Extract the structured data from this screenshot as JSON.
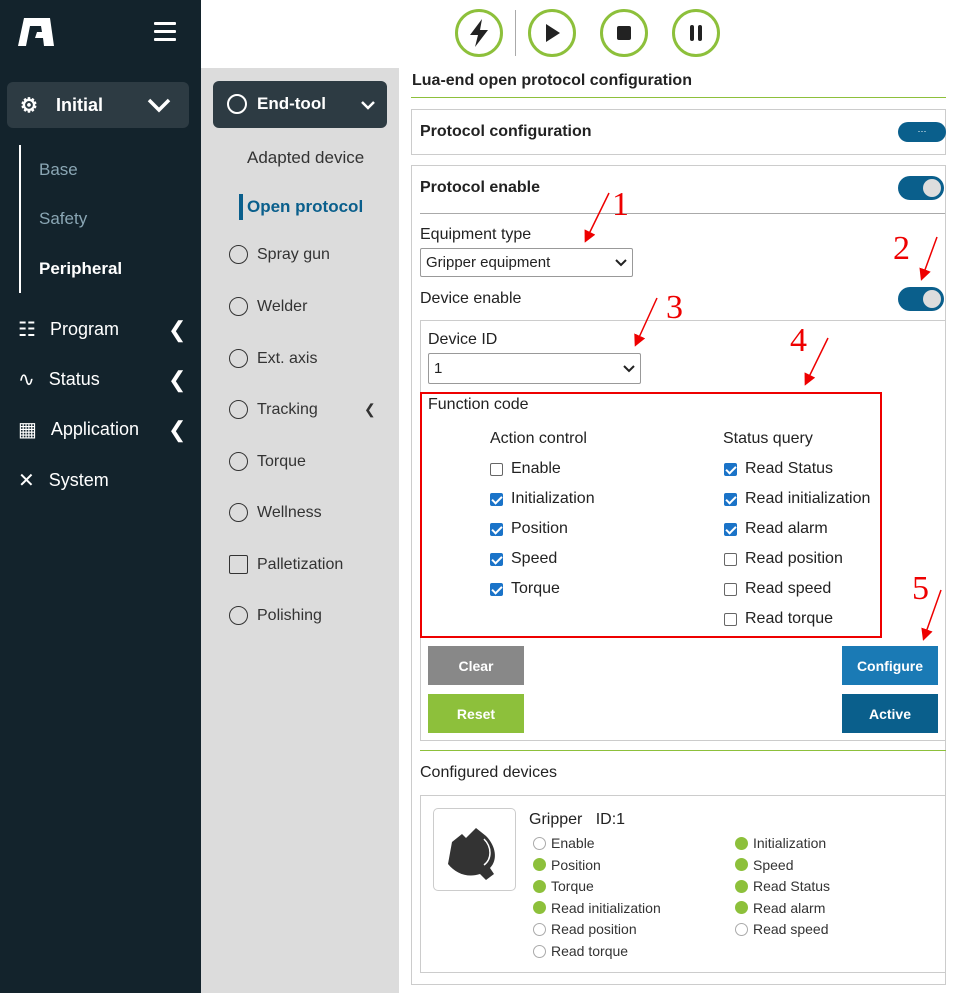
{
  "sidebar": {
    "initial": "Initial",
    "subitems": [
      "Base",
      "Safety",
      "Peripheral"
    ],
    "nav": [
      "Program",
      "Status",
      "Application",
      "System"
    ]
  },
  "toolbar": {
    "buttons": [
      "flash-icon",
      "play-icon",
      "stop-icon",
      "pause-icon"
    ]
  },
  "menu": {
    "endtool": "End-tool",
    "subitems": [
      "Adapted device",
      "Open protocol"
    ],
    "items": [
      "Spray gun",
      "Welder",
      "Ext. axis",
      "Tracking",
      "Torque",
      "Wellness",
      "Palletization",
      "Polishing"
    ]
  },
  "main": {
    "title": "Lua-end open protocol configuration",
    "protocol_config": "Protocol configuration",
    "protocol_enable": "Protocol enable",
    "equipment_type_label": "Equipment type",
    "equipment_type": "Gripper equipment",
    "device_enable": "Device enable",
    "device_id_label": "Device ID",
    "device_id": "1",
    "function_code": "Function code",
    "action_control": "Action control",
    "status_query": "Status query",
    "actions": [
      {
        "label": "Enable",
        "checked": false
      },
      {
        "label": "Initialization",
        "checked": true
      },
      {
        "label": "Position",
        "checked": true
      },
      {
        "label": "Speed",
        "checked": true
      },
      {
        "label": "Torque",
        "checked": true
      }
    ],
    "queries": [
      {
        "label": "Read Status",
        "checked": true
      },
      {
        "label": "Read initialization",
        "checked": true
      },
      {
        "label": "Read alarm",
        "checked": true
      },
      {
        "label": "Read position",
        "checked": false
      },
      {
        "label": "Read speed",
        "checked": false
      },
      {
        "label": "Read torque",
        "checked": false
      }
    ],
    "buttons": {
      "clear": "Clear",
      "reset": "Reset",
      "configure": "Configure",
      "active": "Active"
    },
    "configured_devices": "Configured devices",
    "device": {
      "name": "Gripper",
      "id": "ID:1",
      "left": [
        {
          "label": "Enable",
          "on": false
        },
        {
          "label": "Position",
          "on": true
        },
        {
          "label": "Torque",
          "on": true
        },
        {
          "label": "Read initialization",
          "on": true
        },
        {
          "label": "Read position",
          "on": false
        },
        {
          "label": "Read torque",
          "on": false
        }
      ],
      "right": [
        {
          "label": "Initialization",
          "on": true
        },
        {
          "label": "Speed",
          "on": true
        },
        {
          "label": "Read Status",
          "on": true
        },
        {
          "label": "Read alarm",
          "on": true
        },
        {
          "label": "Read speed",
          "on": false
        }
      ]
    }
  },
  "annotations": [
    "1",
    "2",
    "3",
    "4",
    "5"
  ],
  "colors": {
    "sidebar": "#13232c",
    "accent": "#8dc03b",
    "primary": "#0a5f8c",
    "configure": "#1a7ab5",
    "annotation": "#e00000"
  }
}
